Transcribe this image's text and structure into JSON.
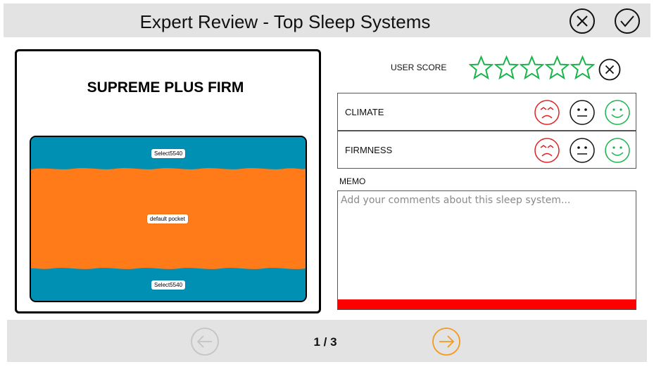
{
  "header": {
    "title": "Expert Review - Top Sleep Systems",
    "close_icon": "close-circle-icon",
    "confirm_icon": "check-circle-icon"
  },
  "product": {
    "title": "SUPREME PLUS FIRM",
    "layers": [
      {
        "label": "Select5540",
        "color": "#0090b3"
      },
      {
        "label": "default pocket",
        "color": "#ff7a18"
      },
      {
        "label": "Select5540",
        "color": "#0090b3"
      }
    ]
  },
  "user_score": {
    "label": "USER SCORE",
    "max_stars": 5,
    "value": 0,
    "star_color": "#19b34a",
    "clear_icon": "close-circle-icon"
  },
  "ratings": [
    {
      "label": "CLIMATE",
      "options": [
        "sad-face-icon",
        "neutral-face-icon",
        "happy-face-icon"
      ]
    },
    {
      "label": "FIRMNESS",
      "options": [
        "sad-face-icon",
        "neutral-face-icon",
        "happy-face-icon"
      ]
    }
  ],
  "face_colors": {
    "sad": "#e02020",
    "neutral": "#111111",
    "happy": "#19b34a"
  },
  "memo": {
    "label": "MEMO",
    "value": "",
    "placeholder": "Add your comments about this sleep system...",
    "bar_color": "#ff0000"
  },
  "pagination": {
    "current": 1,
    "total": 3,
    "display": "1 / 3",
    "prev_icon": "arrow-left-circle-icon",
    "next_icon": "arrow-right-circle-icon",
    "prev_color": "#c4c4c4",
    "next_color": "#f39a1e"
  }
}
